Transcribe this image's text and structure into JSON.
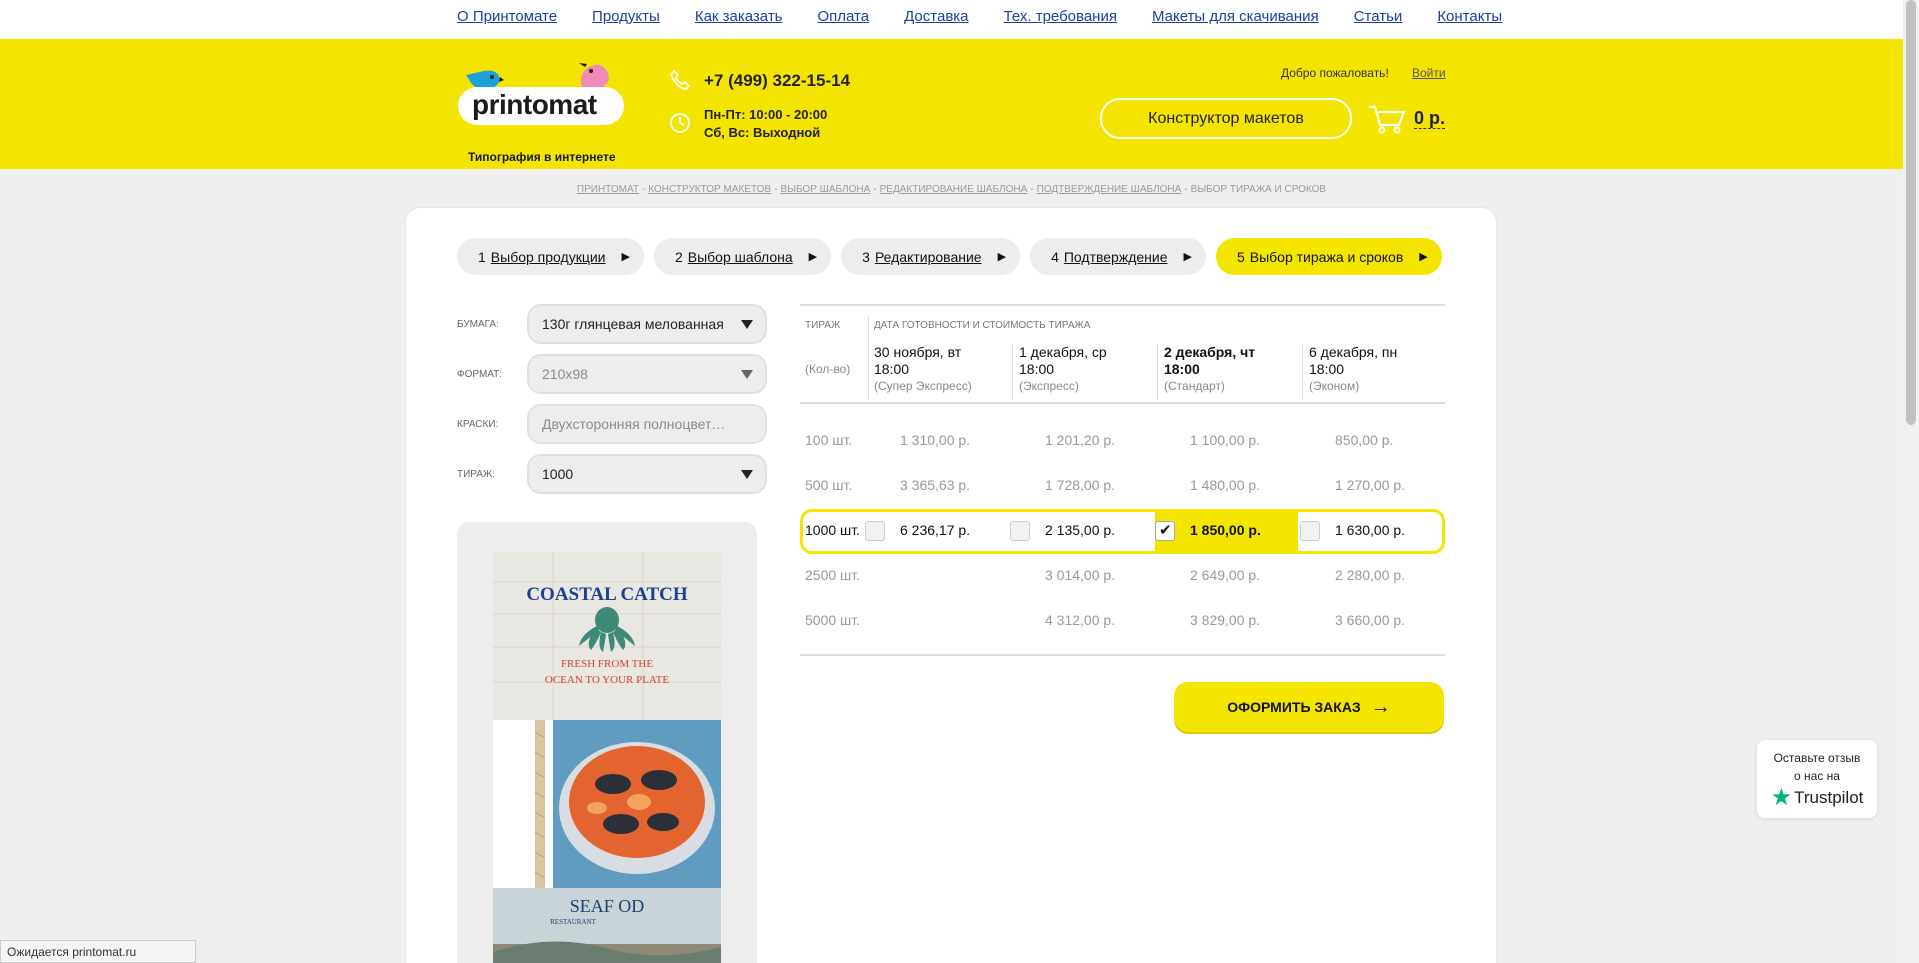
{
  "topnav": {
    "items": [
      "О Принтомате",
      "Продукты",
      "Как заказать",
      "Оплата",
      "Доставка",
      "Тех. требования",
      "Макеты для скачивания",
      "Статьи",
      "Контакты"
    ]
  },
  "header": {
    "brand": "printomat",
    "tagline": "Типография в интернете",
    "phone": "+7 (499) 322-15-14",
    "hours_weekdays": "Пн-Пт: 10:00 - 20:00",
    "hours_weekend": "Сб, Вс: Выходной",
    "welcome": "Добро пожаловать!",
    "login": "Войти",
    "constructor_button": "Конструктор макетов",
    "cart_total": "0 р.",
    "colors": {
      "yellow": "#f4e500"
    }
  },
  "breadcrumb": {
    "links": [
      "Принтомат",
      "Конструктор макетов",
      "Выбор шаблона",
      "Редактирование шаблона",
      "Подтверждение шаблона"
    ],
    "current": "Выбор тиража и сроков"
  },
  "steps": [
    {
      "num": "1",
      "label": "Выбор продукции"
    },
    {
      "num": "2",
      "label": "Выбор шаблона"
    },
    {
      "num": "3",
      "label": "Редактирование"
    },
    {
      "num": "4",
      "label": "Подтверждение"
    },
    {
      "num": "5",
      "label": "Выбор тиража и сроков"
    }
  ],
  "form": {
    "paper_label": "Бумага:",
    "paper_value": "130г глянцевая мелованная",
    "format_label": "Формат:",
    "format_value": "210x98",
    "colors_label": "Краски:",
    "colors_value": "Двухсторонняя полноцветная",
    "run_label": "Тираж:",
    "run_value": "1000"
  },
  "preview": {
    "title": "COASTAL CATCH",
    "subtitle_line1": "FRESH FROM THE",
    "subtitle_line2": "OCEAN TO YOUR PLATE",
    "footer_title": "SEAF OD",
    "footer_sub": "RESTAURANT"
  },
  "price_table": {
    "col_run": "Тираж",
    "col_qty": "(Кол-во)",
    "col_dates": "Дата готовности и стоимость тиража",
    "dates": [
      {
        "date": "30 ноября, вт",
        "time": "18:00",
        "kind": "(Супер Экспресс)"
      },
      {
        "date": "1 декабря, ср",
        "time": "18:00",
        "kind": "(Экспресс)"
      },
      {
        "date": "2 декабря, чт",
        "time": "18:00",
        "kind": "(Стандарт)"
      },
      {
        "date": "6 декабря, пн",
        "time": "18:00",
        "kind": "(Эконом)"
      }
    ],
    "rows": [
      {
        "qty": "100 шт.",
        "prices": [
          "1 310,00 р.",
          "1 201,20 р.",
          "1 100,00 р.",
          "850,00 р."
        ]
      },
      {
        "qty": "500 шт.",
        "prices": [
          "3 365,63 р.",
          "1 728,00 р.",
          "1 480,00 р.",
          "1 270,00 р."
        ]
      },
      {
        "qty": "1000 шт.",
        "prices": [
          "6 236,17 р.",
          "2 135,00 р.",
          "1 850,00 р.",
          "1 630,00 р."
        ]
      },
      {
        "qty": "2500 шт.",
        "prices": [
          "",
          "3 014,00 р.",
          "2 649,00 р.",
          "2 280,00 р."
        ]
      },
      {
        "qty": "5000 шт.",
        "prices": [
          "",
          "4 312,00 р.",
          "3 829,00 р.",
          "3 660,00 р."
        ]
      }
    ]
  },
  "order_button": "Оформить заказ",
  "trustpilot": {
    "line1": "Оставьте отзыв",
    "line2": "о нас на",
    "brand": "Trustpilot"
  },
  "statusbar": "Ожидается printomat.ru"
}
